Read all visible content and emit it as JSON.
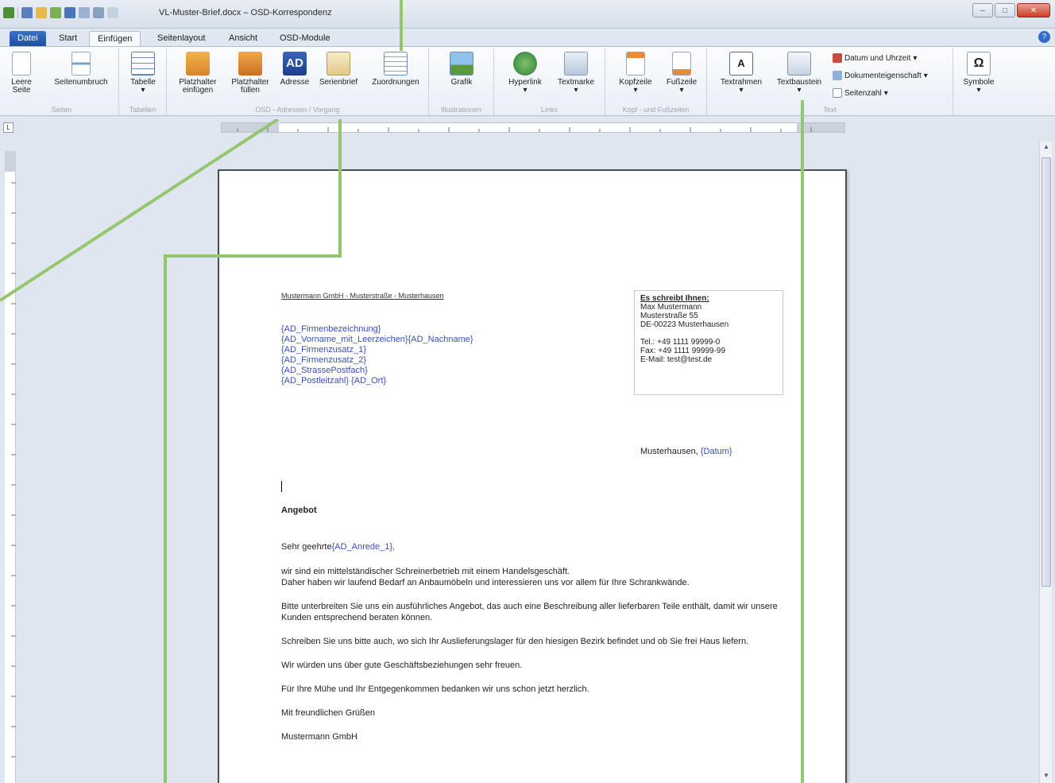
{
  "window": {
    "title": "VL-Muster-Brief.docx – OSD-Korrespondenz",
    "controls": [
      "–",
      "□",
      "✕"
    ]
  },
  "tabs": [
    {
      "label": "Datei"
    },
    {
      "label": "Start"
    },
    {
      "label": "Einfügen"
    },
    {
      "label": "Seitenlayout"
    },
    {
      "label": "Ansicht"
    },
    {
      "label": "OSD-Module"
    }
  ],
  "ribbon": {
    "groups": {
      "seiten": "Seiten",
      "tabellen": "Tabellen",
      "osd": "OSD - Adressen / Vorgang",
      "illustrationen": "Illustrationen",
      "links": "Links",
      "kopf": "Kopf - und Fußzeilen",
      "text": "Text"
    },
    "buttons": {
      "leere_seite_1": "Leere",
      "leere_seite_2": "Seite",
      "seitenumbruch": "Seitenumbruch",
      "tabelle": "Tabelle",
      "platzhalter_einfuegen_1": "Platzhalter",
      "platzhalter_einfuegen_2": "einfügen",
      "platzhalter_fuellen_1": "Platzhalter",
      "platzhalter_fuellen_2": "füllen",
      "adresse": "Adresse",
      "serienbrief": "Serienbrief",
      "zuordnungen": "Zuordnungen",
      "grafik": "Grafik",
      "hyperlink": "Hyperlink",
      "textmarke": "Textmarke",
      "kopfzeile": "Kopfzeile",
      "fusszeile": "Fußzeile",
      "textrahmen": "Textrahmen",
      "textbaustein": "Textbaustein",
      "datum_uhrzeit": "Datum und Uhrzeit",
      "dokumenteigenschaft": "Dokumenteigenschaft",
      "seitenzahl": "Seitenzahl",
      "symbole": "Symbole",
      "omega": "Ω",
      "adresse_icon_text": "AD"
    }
  },
  "letter": {
    "sender_line": "Mustermann GmbH - Musterstraße - Musterhausen",
    "address_placeholders": [
      "{AD_Firmenbezeichnung}",
      "{AD_Vorname_mit_Leerzeichen}{AD_Nachname}",
      "{AD_Firmenzusatz_1}",
      "{AD_Firmenzusatz_2}",
      "{AD_StrassePostfach}",
      "{AD_Postleitzahl} {AD_Ort}"
    ],
    "info_box": {
      "heading": "Es schreibt Ihnen:",
      "name": "Max Mustermann",
      "street": "Musterstraße 55",
      "city": "DE-00223 Musterhausen",
      "tel": "Tel.: +49 1111 99999-0",
      "fax": "Fax: +49 1111 99999-99",
      "email": "E-Mail: test@test.de"
    },
    "date_prefix": "Musterhausen,",
    "date_placeholder": "{Datum}",
    "subject": "Angebot",
    "salutation_prefix": "Sehr geehrte",
    "salutation_placeholder": "{AD_Anrede_1},",
    "paragraphs": [
      "wir sind ein mittelständischer Schreinerbetrieb mit einem Handelsgeschäft.",
      "Daher haben wir laufend Bedarf an Anbaumöbeln und interessieren uns vor allem für Ihre Schrankwände.",
      "Bitte unterbreiten Sie uns ein ausführliches Angebot, das auch eine Beschreibung aller lieferbaren Teile enthält, damit wir unsere Kunden entsprechend beraten können.",
      "Schreiben Sie uns bitte auch, wo sich Ihr Auslieferungslager für den hiesigen Bezirk befindet und ob Sie frei Haus liefern.",
      "Wir würden uns über gute Geschäftsbeziehungen sehr freuen.",
      "Für Ihre Mühe und Ihr Entgegenkommen bedanken wir uns schon jetzt herzlich.",
      "Mit freundlichen Grüßen",
      "Mustermann GmbH"
    ]
  },
  "colors": {
    "callout": "#95c66d",
    "placeholder": "#3a4fb5",
    "file_tab": "#2a5db0"
  }
}
